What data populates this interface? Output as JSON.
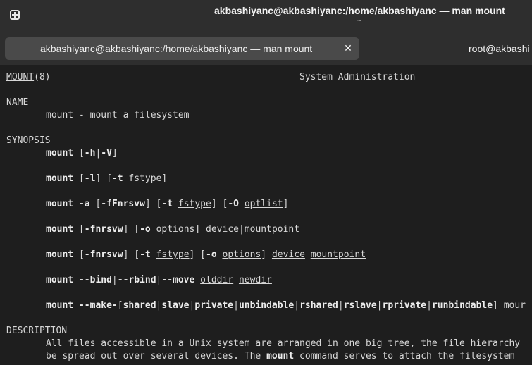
{
  "window": {
    "title": "akbashiyanc@akbashiyanc:/home/akbashiyanc — man mount",
    "subtitle": "~"
  },
  "tabs": [
    {
      "label": "akbashiyanc@akbashiyanc:/home/akbashiyanc — man mount",
      "active": true,
      "close_glyph": "✕"
    },
    {
      "label": "root@akbashi",
      "active": false
    }
  ],
  "icons": {
    "new_tab": "new-tab-icon",
    "close": "close-icon"
  },
  "colors": {
    "background": "#1e1e1e",
    "headerbar": "#2e2e2e",
    "active_tab": "#4a4a4a",
    "text": "#d8d8d8"
  },
  "man": {
    "header_left_name": "MOUNT",
    "header_left_section": "(8)",
    "header_center": "System Administration",
    "name_heading": "NAME",
    "name_line": "mount - mount a filesystem",
    "synopsis_heading": "SYNOPSIS",
    "synopsis": [
      [
        {
          "t": "mount",
          "s": "b"
        },
        {
          "t": " [",
          "s": ""
        },
        {
          "t": "-h",
          "s": "b"
        },
        {
          "t": "|",
          "s": ""
        },
        {
          "t": "-V",
          "s": "b"
        },
        {
          "t": "]",
          "s": ""
        }
      ],
      [
        {
          "t": "mount",
          "s": "b"
        },
        {
          "t": " [",
          "s": ""
        },
        {
          "t": "-l",
          "s": "b"
        },
        {
          "t": "] [",
          "s": ""
        },
        {
          "t": "-t",
          "s": "b"
        },
        {
          "t": " ",
          "s": ""
        },
        {
          "t": "fstype",
          "s": "u"
        },
        {
          "t": "]",
          "s": ""
        }
      ],
      [
        {
          "t": "mount -a",
          "s": "b"
        },
        {
          "t": " [",
          "s": ""
        },
        {
          "t": "-fFnrsvw",
          "s": "b"
        },
        {
          "t": "] [",
          "s": ""
        },
        {
          "t": "-t",
          "s": "b"
        },
        {
          "t": " ",
          "s": ""
        },
        {
          "t": "fstype",
          "s": "u"
        },
        {
          "t": "] [",
          "s": ""
        },
        {
          "t": "-O",
          "s": "b"
        },
        {
          "t": " ",
          "s": ""
        },
        {
          "t": "optlist",
          "s": "u"
        },
        {
          "t": "]",
          "s": ""
        }
      ],
      [
        {
          "t": "mount",
          "s": "b"
        },
        {
          "t": " [",
          "s": ""
        },
        {
          "t": "-fnrsvw",
          "s": "b"
        },
        {
          "t": "] [",
          "s": ""
        },
        {
          "t": "-o",
          "s": "b"
        },
        {
          "t": " ",
          "s": ""
        },
        {
          "t": "options",
          "s": "u"
        },
        {
          "t": "] ",
          "s": ""
        },
        {
          "t": "device",
          "s": "u"
        },
        {
          "t": "|",
          "s": ""
        },
        {
          "t": "mountpoint",
          "s": "u"
        }
      ],
      [
        {
          "t": "mount",
          "s": "b"
        },
        {
          "t": " [",
          "s": ""
        },
        {
          "t": "-fnrsvw",
          "s": "b"
        },
        {
          "t": "] [",
          "s": ""
        },
        {
          "t": "-t",
          "s": "b"
        },
        {
          "t": " ",
          "s": ""
        },
        {
          "t": "fstype",
          "s": "u"
        },
        {
          "t": "] [",
          "s": ""
        },
        {
          "t": "-o",
          "s": "b"
        },
        {
          "t": " ",
          "s": ""
        },
        {
          "t": "options",
          "s": "u"
        },
        {
          "t": "] ",
          "s": ""
        },
        {
          "t": "device",
          "s": "u"
        },
        {
          "t": " ",
          "s": ""
        },
        {
          "t": "mountpoint",
          "s": "u"
        }
      ],
      [
        {
          "t": "mount --bind",
          "s": "b"
        },
        {
          "t": "|",
          "s": ""
        },
        {
          "t": "--rbind",
          "s": "b"
        },
        {
          "t": "|",
          "s": ""
        },
        {
          "t": "--move",
          "s": "b"
        },
        {
          "t": " ",
          "s": ""
        },
        {
          "t": "olddir",
          "s": "u"
        },
        {
          "t": " ",
          "s": ""
        },
        {
          "t": "newdir",
          "s": "u"
        }
      ],
      [
        {
          "t": "mount --make-",
          "s": "b"
        },
        {
          "t": "[",
          "s": ""
        },
        {
          "t": "shared",
          "s": "b"
        },
        {
          "t": "|",
          "s": ""
        },
        {
          "t": "slave",
          "s": "b"
        },
        {
          "t": "|",
          "s": ""
        },
        {
          "t": "private",
          "s": "b"
        },
        {
          "t": "|",
          "s": ""
        },
        {
          "t": "unbindable",
          "s": "b"
        },
        {
          "t": "|",
          "s": ""
        },
        {
          "t": "rshared",
          "s": "b"
        },
        {
          "t": "|",
          "s": ""
        },
        {
          "t": "rslave",
          "s": "b"
        },
        {
          "t": "|",
          "s": ""
        },
        {
          "t": "rprivate",
          "s": "b"
        },
        {
          "t": "|",
          "s": ""
        },
        {
          "t": "runbindable",
          "s": "b"
        },
        {
          "t": "] ",
          "s": ""
        },
        {
          "t": "mour",
          "s": "u"
        }
      ]
    ],
    "description_heading": "DESCRIPTION",
    "description": [
      [
        {
          "t": "All files accessible in a Unix system are arranged in one big tree, the file hierarchy",
          "s": ""
        }
      ],
      [
        {
          "t": "be spread out over several devices. The ",
          "s": ""
        },
        {
          "t": "mount",
          "s": "b"
        },
        {
          "t": " command serves to attach the filesystem ",
          "s": ""
        }
      ]
    ]
  }
}
